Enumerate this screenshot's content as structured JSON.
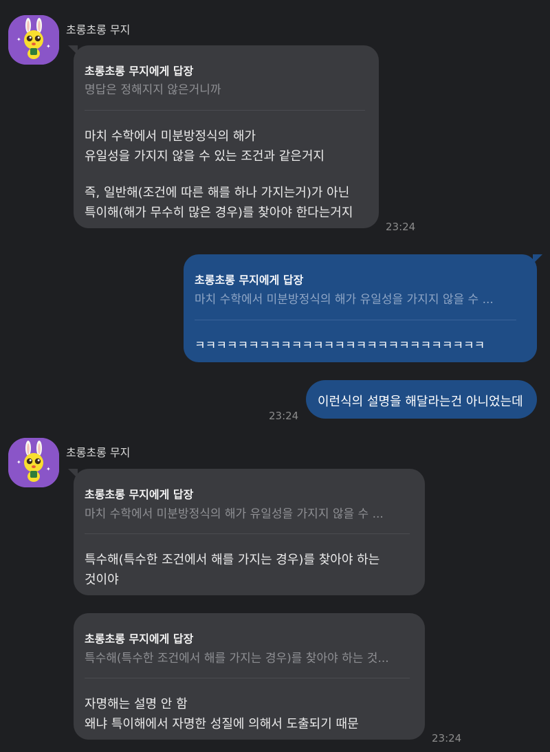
{
  "colors": {
    "background": "#1e1f22",
    "incoming_bubble": "#3a3b3f",
    "outgoing_bubble": "#1f4d86",
    "avatar": "#8a55c8"
  },
  "messages": [
    {
      "sender": "초롱초롱 무지",
      "avatar_icon": "muzi-avatar-icon",
      "reply_title": "초롱초롱 무지에게 답장",
      "reply_preview": "명답은 정해지지 않은거니까",
      "lines": [
        "마치 수학에서 미분방정식의 해가",
        "유일성을 가지지 않을 수 있는 조건과 같은거지",
        "",
        "즉, 일반해(조건에 따른 해를 하나 가지는거)가 아닌",
        "특이해(해가 무수히 많은 경우)를 찾아야 한다는거지"
      ],
      "time": "23:24"
    },
    {
      "reply_title": "초롱초롱 무지에게 답장",
      "reply_preview": "마치 수학에서 미분방정식의 해가 유일성을 가지지 않을 수 ...",
      "lines": [
        "ㅋㅋㅋㅋㅋㅋㅋㅋㅋㅋㅋㅋㅋㅋㅋㅋㅋㅋㅋㅋㅋㅋㅋㅋㅋㅋㅋ"
      ]
    },
    {
      "lines": [
        "이런식의 설명을 해달라는건 아니었는데"
      ],
      "time": "23:24"
    },
    {
      "sender": "초롱초롱 무지",
      "avatar_icon": "muzi-avatar-icon",
      "reply_title": "초롱초롱 무지에게 답장",
      "reply_preview": "마치 수학에서 미분방정식의 해가 유일성을 가지지 않을 수 ...",
      "lines": [
        "특수해(특수한 조건에서 해를 가지는 경우)를 찾아야 하는",
        "것이야"
      ]
    },
    {
      "reply_title": "초롱초롱 무지에게 답장",
      "reply_preview": "특수해(특수한 조건에서 해를 가지는 경우)를 찾아야 하는 것...",
      "lines": [
        "자명해는 설명 안 함",
        "왜냐 특이해에서 자명한 성질에 의해서 도출되기 때문"
      ],
      "time": "23:24"
    }
  ]
}
